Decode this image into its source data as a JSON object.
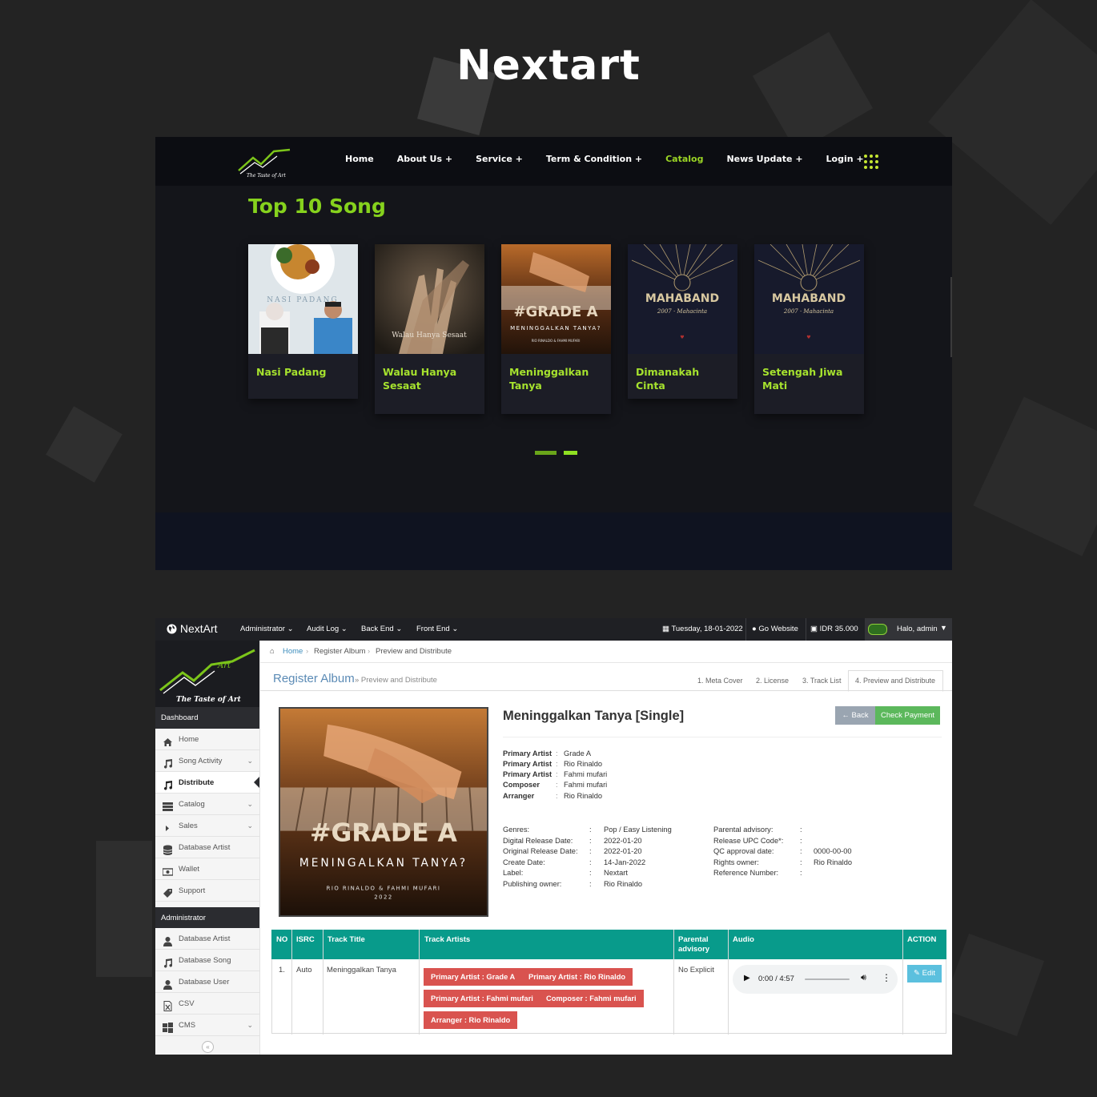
{
  "brand": {
    "title": "Nextart"
  },
  "site": {
    "nav": [
      {
        "label": "Home"
      },
      {
        "label": "About Us +"
      },
      {
        "label": "Service +"
      },
      {
        "label": "Term & Condition +"
      },
      {
        "label": "Catalog",
        "active": true
      },
      {
        "label": "News Update +"
      },
      {
        "label": "Login +"
      }
    ],
    "section_title": "Top 10 Song",
    "songs": [
      {
        "title": "Nasi Padang"
      },
      {
        "title": "Walau Hanya Sesaat"
      },
      {
        "title": "Meninggalkan Tanya"
      },
      {
        "title": "Dimanakah Cinta"
      },
      {
        "title": "Setengah Jiwa Mati"
      }
    ],
    "colors": {
      "accent": "#86d21d",
      "header_bg": "#0c0d12",
      "page_bg": "#14151a"
    }
  },
  "admin": {
    "app_name": "NextArt",
    "menu": [
      "Administrator",
      "Audit Log",
      "Back End",
      "Front End"
    ],
    "date": "Tuesday, 18-01-2022",
    "go_website": "Go Website",
    "balance": "IDR 35.000",
    "greeting": "Halo, admin",
    "sidebar": {
      "section1": "Dashboard",
      "items1": [
        {
          "label": "Home",
          "icon": "home-icon"
        },
        {
          "label": "Song Activity",
          "icon": "music-icon",
          "expandable": true
        },
        {
          "label": "Distribute",
          "icon": "music-icon",
          "active": true
        },
        {
          "label": "Catalog",
          "icon": "list-icon",
          "expandable": true
        },
        {
          "label": "Sales",
          "icon": "caret-right-icon",
          "expandable": true
        },
        {
          "label": "Database Artist",
          "icon": "database-icon"
        },
        {
          "label": "Wallet",
          "icon": "wallet-icon"
        },
        {
          "label": "Support",
          "icon": "tag-icon"
        }
      ],
      "section2": "Administrator",
      "items2": [
        {
          "label": "Database Artist",
          "icon": "user-icon"
        },
        {
          "label": "Database Song",
          "icon": "music-icon"
        },
        {
          "label": "Database User",
          "icon": "user-icon"
        },
        {
          "label": "CSV",
          "icon": "file-excel-icon"
        },
        {
          "label": "CMS",
          "icon": "windows-icon",
          "expandable": true
        }
      ]
    },
    "breadcrumb": [
      "Home",
      "Register Album",
      "Preview and Distribute"
    ],
    "page_title": "Register Album",
    "page_subtitle": "» Preview and Distribute",
    "steps": [
      "1. Meta Cover",
      "2. License",
      "3. Track List",
      "4. Preview and Distribute"
    ],
    "album": {
      "name": "Meninggalkan Tanya [Single]",
      "back_label": "Back",
      "check_label": "Check Payment",
      "credits": [
        {
          "role": "Primary Artist",
          "name": "Grade A"
        },
        {
          "role": "Primary Artist",
          "name": "Rio Rinaldo"
        },
        {
          "role": "Primary Artist",
          "name": "Fahmi mufari"
        },
        {
          "role": "Composer",
          "name": "Fahmi mufari"
        },
        {
          "role": "Arranger",
          "name": "Rio Rinaldo"
        }
      ],
      "details_left": [
        {
          "k": "Genres:",
          "v": "Pop / Easy Listening"
        },
        {
          "k": "Digital Release Date:",
          "v": "2022-01-20"
        },
        {
          "k": "Original Release Date:",
          "v": "2022-01-20"
        },
        {
          "k": "Create Date:",
          "v": "14-Jan-2022"
        },
        {
          "k": "Label:",
          "v": "Nextart"
        },
        {
          "k": "Publishing owner:",
          "v": "Rio Rinaldo"
        }
      ],
      "details_right": [
        {
          "k": "Parental advisory:",
          "v": ""
        },
        {
          "k": "Release UPC Code*:",
          "v": ""
        },
        {
          "k": "QC approval date:",
          "v": "0000-00-00"
        },
        {
          "k": "Rights owner:",
          "v": "Rio Rinaldo"
        },
        {
          "k": "Reference Number:",
          "v": ""
        }
      ]
    },
    "table": {
      "headers": [
        "NO",
        "ISRC",
        "Track Title",
        "Track Artists",
        "Parental advisory",
        "Audio",
        "ACTION"
      ],
      "row": {
        "no": "1.",
        "isrc": "Auto",
        "title": "Meninggalkan Tanya",
        "artists": [
          "Primary Artist : Grade A",
          "Primary Artist : Rio Rinaldo",
          "Primary Artist : Fahmi mufari",
          "Composer : Fahmi mufari",
          "Arranger : Rio Rinaldo"
        ],
        "parental": "No Explicit",
        "audio_time": "0:00 / 4:57",
        "action": "Edit"
      }
    }
  }
}
